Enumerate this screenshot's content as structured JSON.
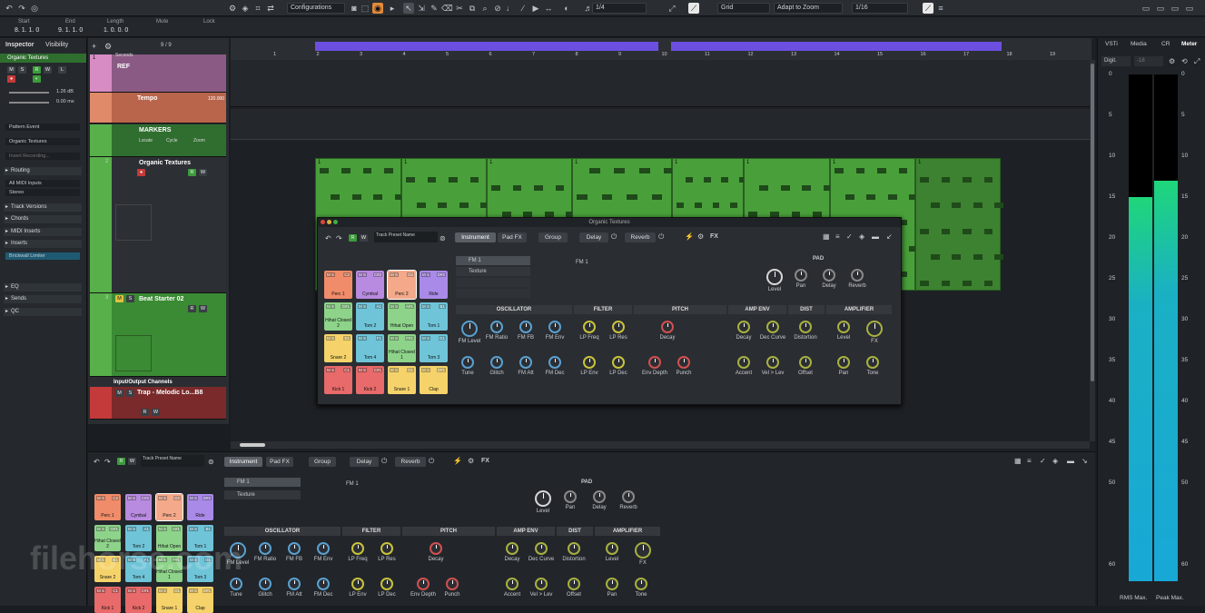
{
  "toolbar": {
    "configurations": "Configurations",
    "quantize_ratio": "1/4",
    "grid": "Grid",
    "zoom_mode": "Adapt to Zoom",
    "quant": "1/16"
  },
  "transport": {
    "start_label": "Start",
    "start": "8. 1. 1. 0",
    "end_label": "End",
    "end": "9. 1. 1. 0",
    "length_label": "Length",
    "length": "1. 0. 0. 0",
    "mute_label": "Mute",
    "lock_label": "Lock"
  },
  "inspector": {
    "tab_inspector": "Inspector",
    "tab_visibility": "Visibility",
    "track_name": "Organic Textures",
    "volume": "1.26 dB",
    "pan": "0.00 ms",
    "pattern_event": "Pattern Event",
    "instrument": "Organic Textures",
    "insert_recording": "Insert Recording...",
    "routing": "Routing",
    "input": "All MIDI Inputs",
    "output": "Stereo",
    "track_versions": "Track Versions",
    "chords": "Chords",
    "midi_inserts": "MIDI Inserts",
    "inserts": "Inserts",
    "insert_slot": "Brickwall Limiter",
    "eq": "EQ",
    "sends": "Sends",
    "qc": "QC"
  },
  "tracklist": {
    "count": "9 / 9",
    "tracks": [
      {
        "num": "1",
        "name": "REF",
        "sub": "Seconds"
      },
      {
        "name": "Tempo",
        "val": "120.000"
      },
      {
        "name": "MARKERS",
        "locate": "Locate",
        "cycle": "Cycle",
        "zoom": "Zoom"
      },
      {
        "num": "2",
        "name": "Organic Textures"
      },
      {
        "num": "3",
        "name": "Beat Starter 02"
      },
      {
        "name": "Input/Output Channels"
      },
      {
        "name": "Trap - Melodic Lo...B8"
      }
    ]
  },
  "ruler": {
    "ticks": [
      "1",
      "2",
      "3",
      "4",
      "5",
      "6",
      "7",
      "8",
      "9",
      "10",
      "11",
      "12",
      "13",
      "14",
      "15",
      "16",
      "17",
      "18",
      "19"
    ]
  },
  "clips": {
    "label": "1"
  },
  "plugin": {
    "title": "Organic Textures",
    "preset": "Track Preset Name",
    "tabs": {
      "instrument": "Instrument",
      "padfx": "Pad FX",
      "group": "Group",
      "delay": "Delay",
      "reverb": "Reverb",
      "fx": "FX"
    },
    "layers": [
      "FM 1",
      "Texture"
    ],
    "fm_label": "FM 1",
    "pad_section": "PAD",
    "pad_knobs": [
      "Level",
      "Pan",
      "Delay",
      "Reverb"
    ],
    "pads": [
      {
        "key": "C2",
        "name": "Perc 1",
        "color": "#f08c6a"
      },
      {
        "key": "C#2",
        "name": "Cymbal",
        "color": "#b88ae0"
      },
      {
        "key": "D2",
        "name": "Perc 2",
        "color": "#f4a98a"
      },
      {
        "key": "D#2",
        "name": "Ride",
        "color": "#a98ae8"
      },
      {
        "key": "G#1",
        "name": "Hihat Closed 2",
        "color": "#8ed38a"
      },
      {
        "key": "A1",
        "name": "Tom 2",
        "color": "#6fc4d8"
      },
      {
        "key": "A#1",
        "name": "Hihat Open",
        "color": "#8ed38a"
      },
      {
        "key": "B1",
        "name": "Tom 1",
        "color": "#6fc4d8"
      },
      {
        "key": "E1",
        "name": "Snare 2",
        "color": "#f5d36a"
      },
      {
        "key": "F1",
        "name": "Tom 4",
        "color": "#6fc4d8"
      },
      {
        "key": "F#1",
        "name": "Hihat Closed 1",
        "color": "#8ed38a"
      },
      {
        "key": "G1",
        "name": "Tom 3",
        "color": "#6fc4d8"
      },
      {
        "key": "C1",
        "name": "Kick 1",
        "color": "#e86a6a"
      },
      {
        "key": "C#1",
        "name": "Kick 2",
        "color": "#e86a6a"
      },
      {
        "key": "D1",
        "name": "Snare 1",
        "color": "#f5d36a"
      },
      {
        "key": "D#1",
        "name": "Clap",
        "color": "#f5d36a"
      }
    ],
    "sections": {
      "oscillator": "OSCILLATOR",
      "filter": "FILTER",
      "pitch": "PITCH",
      "ampenv": "AMP ENV",
      "dist": "DIST",
      "amplifier": "AMPLIFIER"
    },
    "knobs": {
      "osc1": [
        "FM Level",
        "FM Ratio",
        "FM FB",
        "FM Env"
      ],
      "osc2": [
        "Tune",
        "Glitch",
        "FM Att",
        "FM Dec"
      ],
      "filt1": [
        "LP Freq",
        "LP Res"
      ],
      "filt2": [
        "LP Env",
        "LP Dec"
      ],
      "pitch1": [
        "Decay"
      ],
      "pitch2": [
        "Env Depth",
        "Punch"
      ],
      "amp1": [
        "Decay",
        "Dec Curve"
      ],
      "amp2": [
        "Accent",
        "Vel > Lev"
      ],
      "dist1": [
        "Distortion"
      ],
      "dist2": [
        "Offset"
      ],
      "ampl1": [
        "Level",
        "FX"
      ],
      "ampl2": [
        "Pan",
        "Tone"
      ]
    }
  },
  "meter": {
    "tabs": [
      "VSTi",
      "Media",
      "CR",
      "Meter"
    ],
    "mode": "Digit.",
    "scale_value": "-18",
    "scale": [
      "0",
      "5",
      "10",
      "15",
      "20",
      "25",
      "30",
      "35",
      "40",
      "45",
      "50",
      "60"
    ],
    "left_peak": -15,
    "right_peak": -13,
    "rms_label": "RMS Max.",
    "peak_label": "Peak Max."
  },
  "watermark": "filehorse.com",
  "colors": {
    "accent": "#6c4fe0",
    "clip": "#49a03a",
    "meter_green": "#1fd67a",
    "meter_cyan": "#18b8d6"
  }
}
